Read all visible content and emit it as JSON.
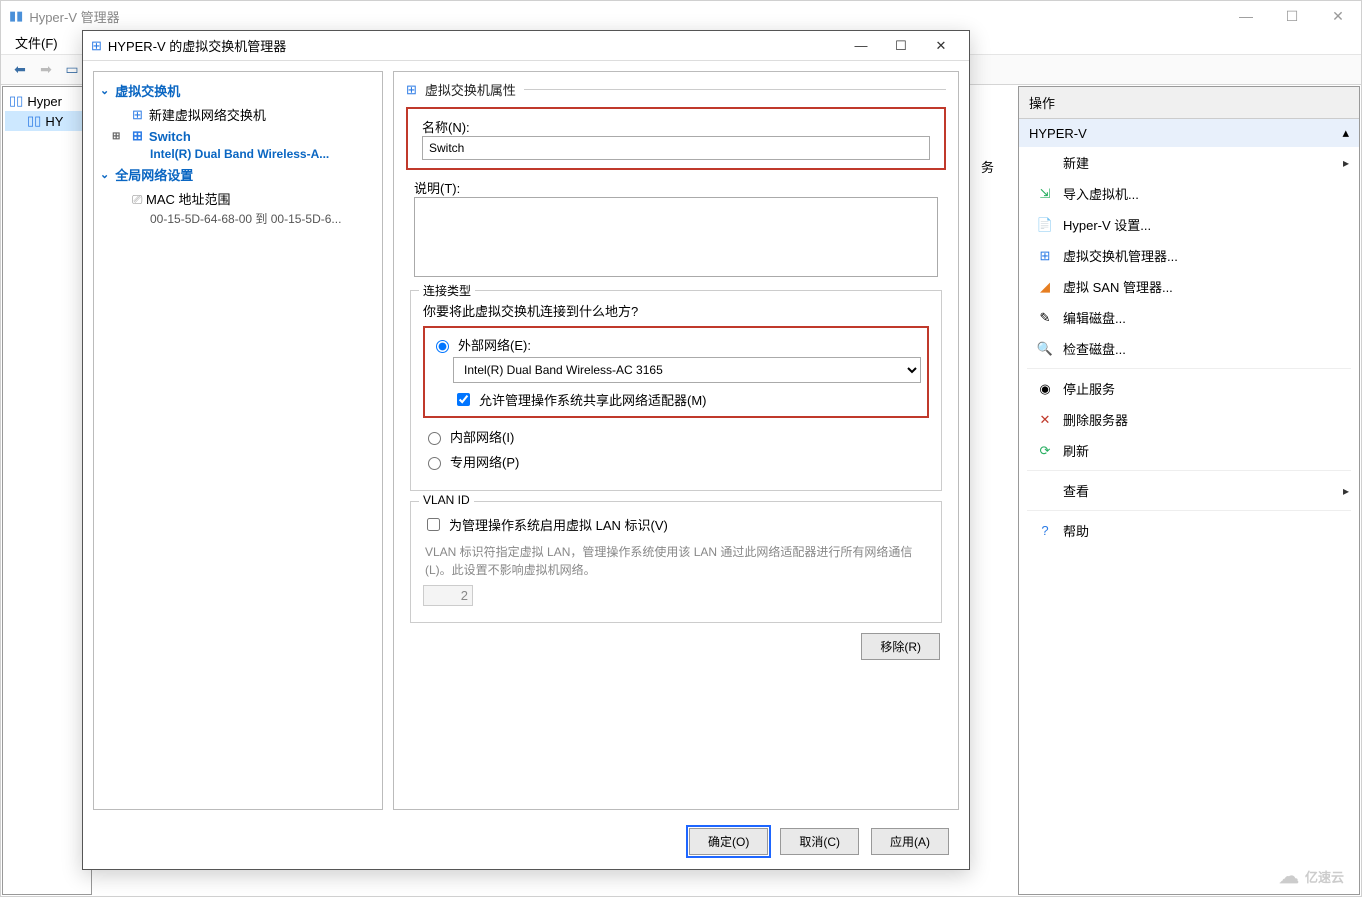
{
  "outerWindow": {
    "title": "Hyper-V 管理器",
    "menu_file": "文件(F)",
    "tree_root": "Hyper",
    "tree_child": "HY"
  },
  "actions": {
    "header": "操作",
    "group": "HYPER-V",
    "items": [
      {
        "label": "新建",
        "icon": "new",
        "arrow": true
      },
      {
        "label": "导入虚拟机...",
        "icon": "import"
      },
      {
        "label": "Hyper-V 设置...",
        "icon": "settings"
      },
      {
        "label": "虚拟交换机管理器...",
        "icon": "vswitch"
      },
      {
        "label": "虚拟 SAN 管理器...",
        "icon": "san"
      },
      {
        "label": "编辑磁盘...",
        "icon": "editdisk"
      },
      {
        "label": "检查磁盘...",
        "icon": "inspectdisk"
      },
      {
        "label": "停止服务",
        "icon": "stop"
      },
      {
        "label": "删除服务器",
        "icon": "delete"
      },
      {
        "label": "刷新",
        "icon": "refresh"
      },
      {
        "label": "查看",
        "icon": "view",
        "arrow": true
      },
      {
        "label": "帮助",
        "icon": "help"
      }
    ]
  },
  "dialog": {
    "title": "HYPER-V 的虚拟交换机管理器",
    "left": {
      "cat1": "虚拟交换机",
      "leaf_new": "新建虚拟网络交换机",
      "leaf_switch": "Switch",
      "leaf_switch_sub": "Intel(R) Dual Band Wireless-A...",
      "cat2": "全局网络设置",
      "leaf_mac": "MAC 地址范围",
      "mac_range": "00-15-5D-64-68-00 到 00-15-5D-6..."
    },
    "right": {
      "sectionTitle": "虚拟交换机属性",
      "name_label": "名称(N):",
      "name_value": "Switch",
      "desc_label": "说明(T):",
      "desc_value": "",
      "conn_group": "连接类型",
      "conn_prompt": "你要将此虚拟交换机连接到什么地方?",
      "rb_external": "外部网络(E):",
      "adapter_value": "Intel(R) Dual Band Wireless-AC 3165",
      "chk_allow_mgmt": "允许管理操作系统共享此网络适配器(M)",
      "rb_internal": "内部网络(I)",
      "rb_private": "专用网络(P)",
      "vlan_group": "VLAN ID",
      "chk_vlan": "为管理操作系统启用虚拟 LAN 标识(V)",
      "vlan_help": "VLAN 标识符指定虚拟 LAN，管理操作系统使用该 LAN 通过此网络适配器进行所有网络通信(L)。此设置不影响虚拟机网络。",
      "vlan_value": "2",
      "btn_remove": "移除(R)"
    },
    "buttons": {
      "ok": "确定(O)",
      "cancel": "取消(C)",
      "apply": "应用(A)"
    }
  },
  "extra": {
    "truncated_text": "务"
  },
  "watermark": "亿速云"
}
